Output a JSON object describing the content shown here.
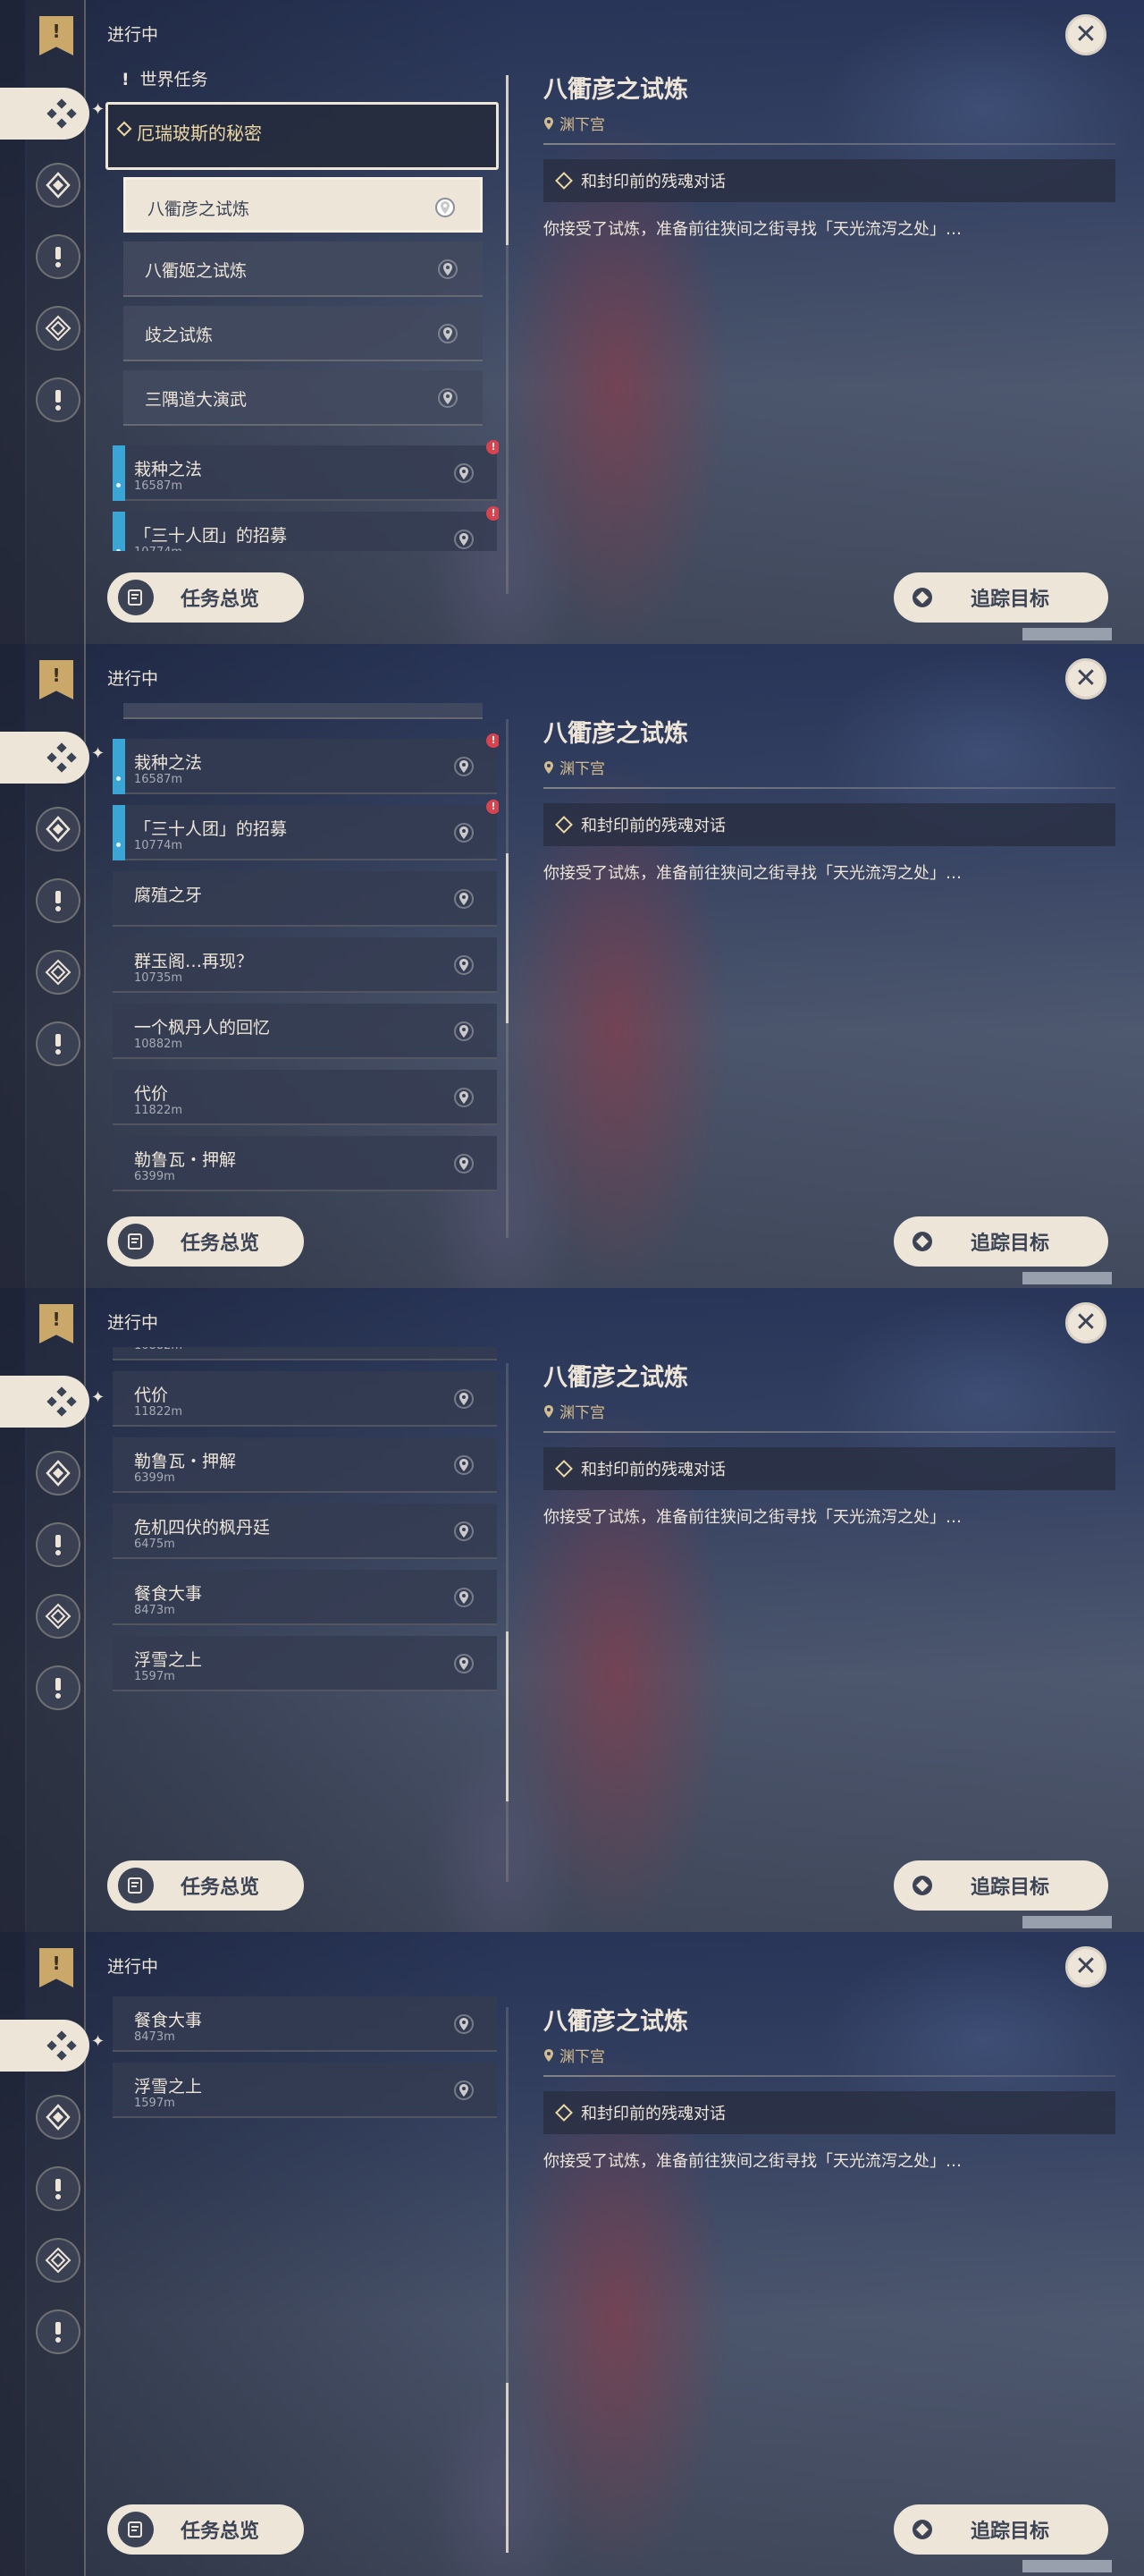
{
  "header": {
    "section_title": "进行中"
  },
  "world_quests_label": "世界任务",
  "quest_group": {
    "name": "厄瑞玻斯的秘密"
  },
  "sub_quests": [
    {
      "name": "八衢彦之试炼",
      "selected": true
    },
    {
      "name": "八衢姬之试炼",
      "selected": false
    },
    {
      "name": "歧之试炼",
      "selected": false
    },
    {
      "name": "三隅道大演武",
      "selected": false
    }
  ],
  "quests": [
    {
      "name": "栽种之法",
      "distance": "16587m",
      "tracked": true,
      "alert": true
    },
    {
      "name": "「三十人团」的招募",
      "distance": "10774m",
      "tracked": true,
      "alert": true
    },
    {
      "name": "腐殖之牙",
      "distance": "",
      "tracked": false,
      "alert": false
    },
    {
      "name": "群玉阁…再现？",
      "distance": "10735m",
      "tracked": false,
      "alert": false
    },
    {
      "name": "一个枫丹人的回忆",
      "distance": "10882m",
      "tracked": false,
      "alert": false
    },
    {
      "name": "代价",
      "distance": "11822m",
      "tracked": false,
      "alert": false
    },
    {
      "name": "勒鲁瓦・押解",
      "distance": "6399m",
      "tracked": false,
      "alert": false
    },
    {
      "name": "危机四伏的枫丹廷",
      "distance": "6475m",
      "tracked": false,
      "alert": false
    },
    {
      "name": "餐食大事",
      "distance": "8473m",
      "tracked": false,
      "alert": false
    },
    {
      "name": "浮雪之上",
      "distance": "1597m",
      "tracked": false,
      "alert": false
    }
  ],
  "detail": {
    "title": "八衢彦之试炼",
    "location": "渊下宫",
    "objective": "和封印前的残魂对话",
    "description": "你接受了试炼，准备前往狭间之街寻找「天光流泻之处」…"
  },
  "buttons": {
    "overview": "任务总览",
    "track": "追踪目标"
  },
  "colors": {
    "accent_cream": "#ece5d8",
    "gold": "#c9a869",
    "tracked_blue": "#3ba6d6",
    "alert_red": "#d9434d"
  }
}
